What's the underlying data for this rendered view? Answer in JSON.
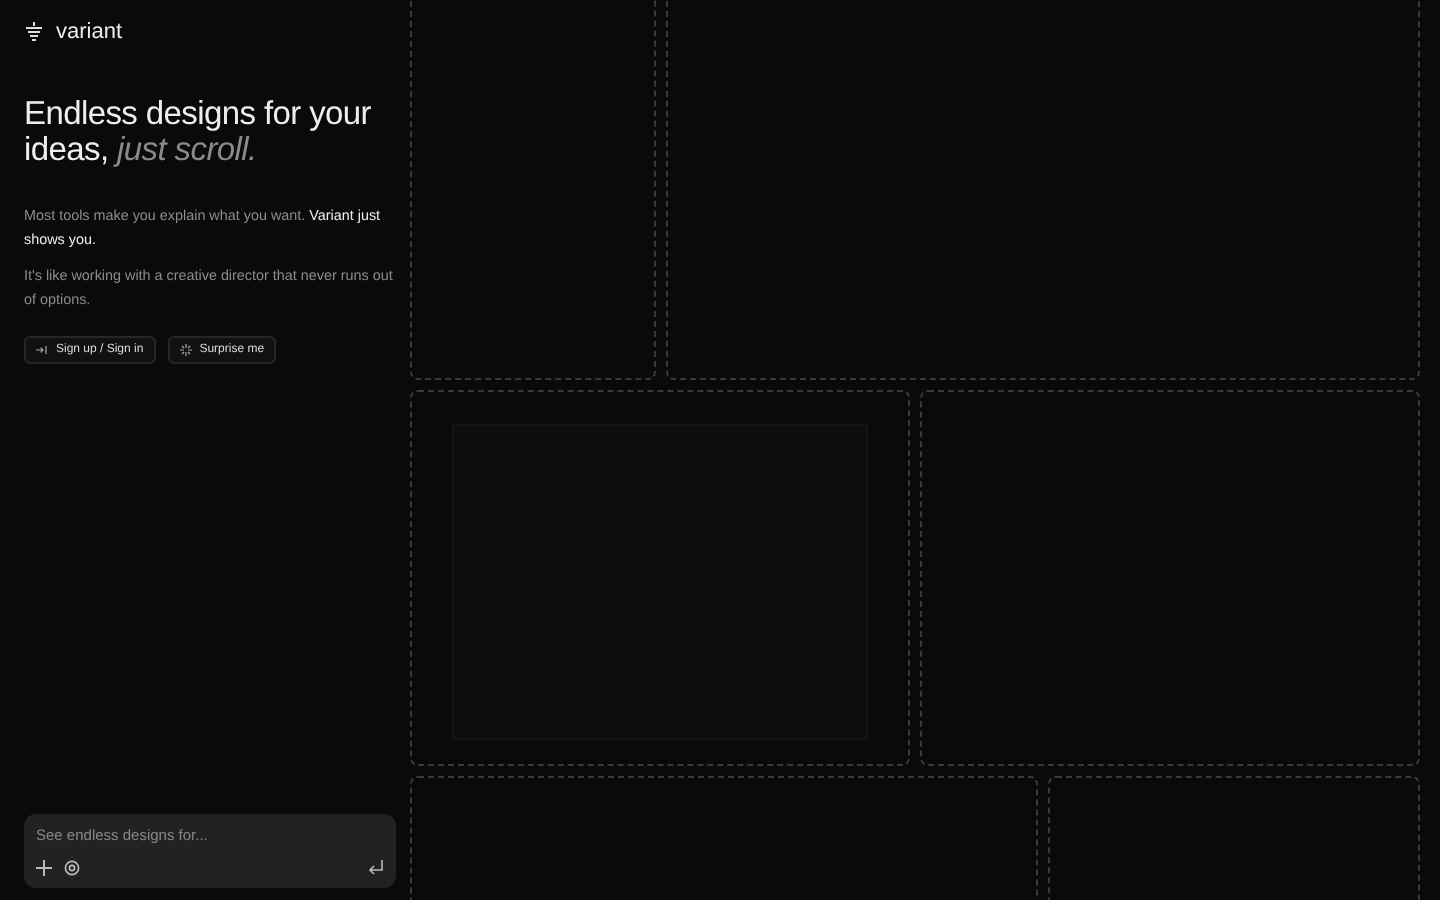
{
  "brand": {
    "name": "variant"
  },
  "headline": {
    "main": "Endless designs for your ideas,",
    "accent": "just scroll."
  },
  "paragraphs": [
    "Most tools make you explain what you want. **Variant just shows you.**",
    "It's like working with a creative director that never runs out of options."
  ],
  "actions": [
    {
      "kind": "signin",
      "label": "Sign up / Sign in"
    },
    {
      "kind": "surprise",
      "label": "Surprise me"
    }
  ],
  "prompt": {
    "placeholder": "See endless designs for..."
  }
}
